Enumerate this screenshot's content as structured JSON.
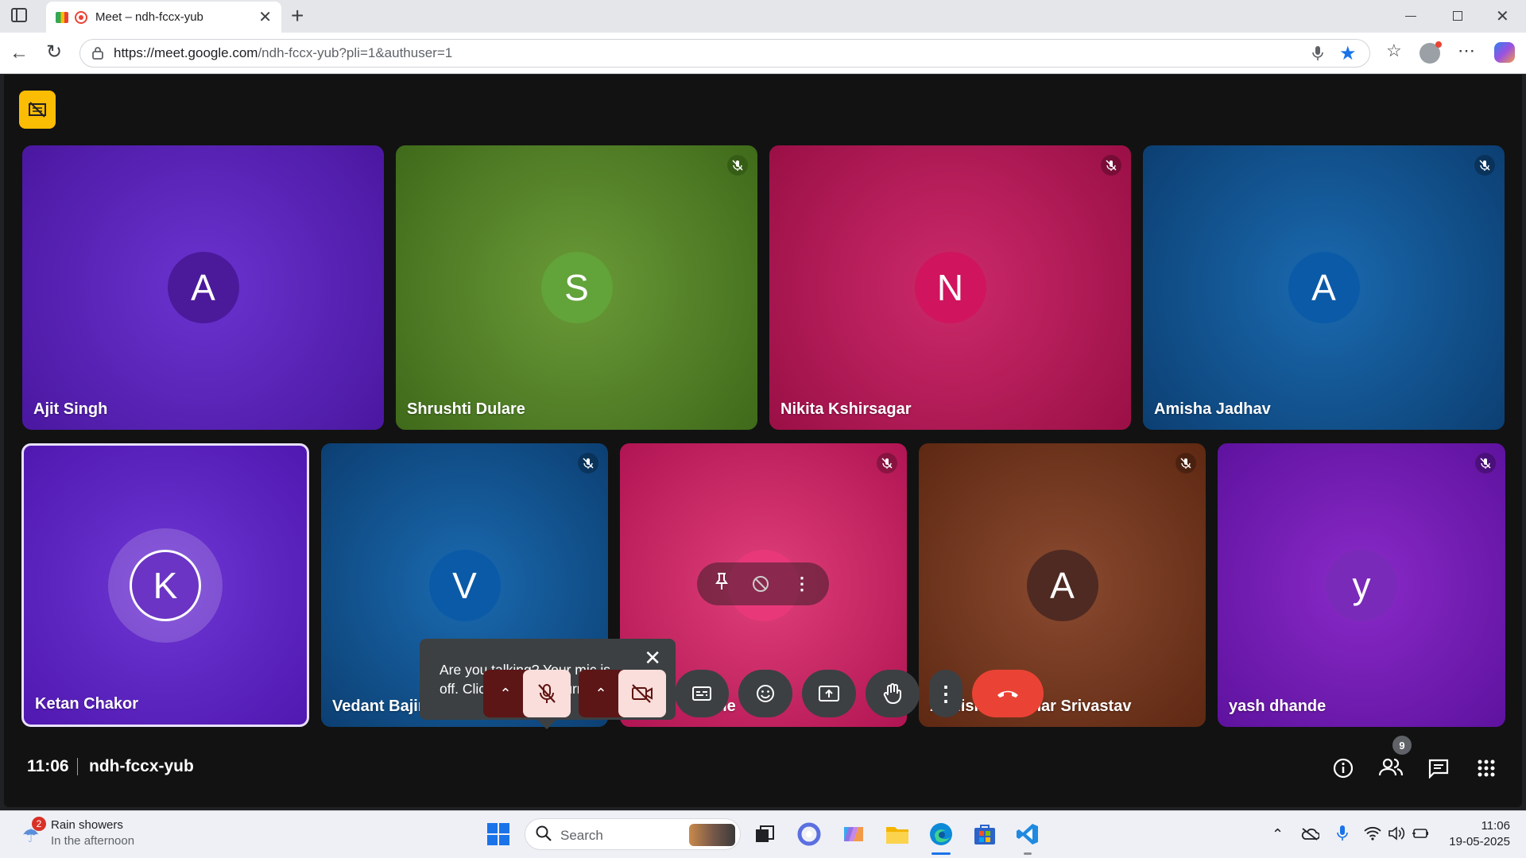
{
  "browser": {
    "tab_title": "Meet – ndh-fccx-yub",
    "url_host": "https://meet.google.com",
    "url_path": "/ndh-fccx-yub?pli=1&authuser=1"
  },
  "meeting": {
    "time": "11:06",
    "code": "ndh-fccx-yub",
    "people_count": "9"
  },
  "participants": [
    {
      "initial": "A",
      "name": "Ajit Singh",
      "muted": false,
      "bg": "#5b1fb8",
      "avatar": "#4a1a9a"
    },
    {
      "initial": "S",
      "name": "Shrushti Dulare",
      "muted": true,
      "bg": "#4e7a24",
      "avatar": "#62a33a"
    },
    {
      "initial": "N",
      "name": "Nikita Kshirsagar",
      "muted": true,
      "bg": "#a81450",
      "avatar": "#d0145e"
    },
    {
      "initial": "A",
      "name": "Amisha Jadhav",
      "muted": true,
      "bg": "#0d4b86",
      "avatar": "#0b5aa8"
    },
    {
      "initial": "K",
      "name": "Ketan Chakor",
      "muted": false,
      "bg": "#5a20b8",
      "avatar": "#6b34c4"
    },
    {
      "initial": "V",
      "name": "Vedant Bajir",
      "muted": true,
      "bg": "#0d4b86",
      "avatar": "#0b5aa8"
    },
    {
      "initial": "",
      "name": "t Kolhe",
      "muted": true,
      "bg": "#c0185c",
      "avatar": "#e8387a"
    },
    {
      "initial": "A",
      "name": "Abhishek Kumar Srivastav",
      "muted": true,
      "bg": "#6a2e17",
      "avatar": "#4e2a22"
    },
    {
      "initial": "y",
      "name": "yash dhande",
      "muted": true,
      "bg": "#6a1aa8",
      "avatar": "#7a2ab8"
    }
  ],
  "tooltip": {
    "text": "Are you talking? Your mic is off. Click the mic to turn it on."
  },
  "taskbar": {
    "weather_title": "Rain showers",
    "weather_sub": "In the afternoon",
    "weather_badge": "2",
    "search_placeholder": "Search",
    "clock_time": "11:06",
    "clock_date": "19-05-2025"
  },
  "colors": {
    "end_call": "#ea4335",
    "mic_off": "#f9dedc",
    "arrow_bg": "#5c1616",
    "accent_yellow": "#fbbc04"
  }
}
